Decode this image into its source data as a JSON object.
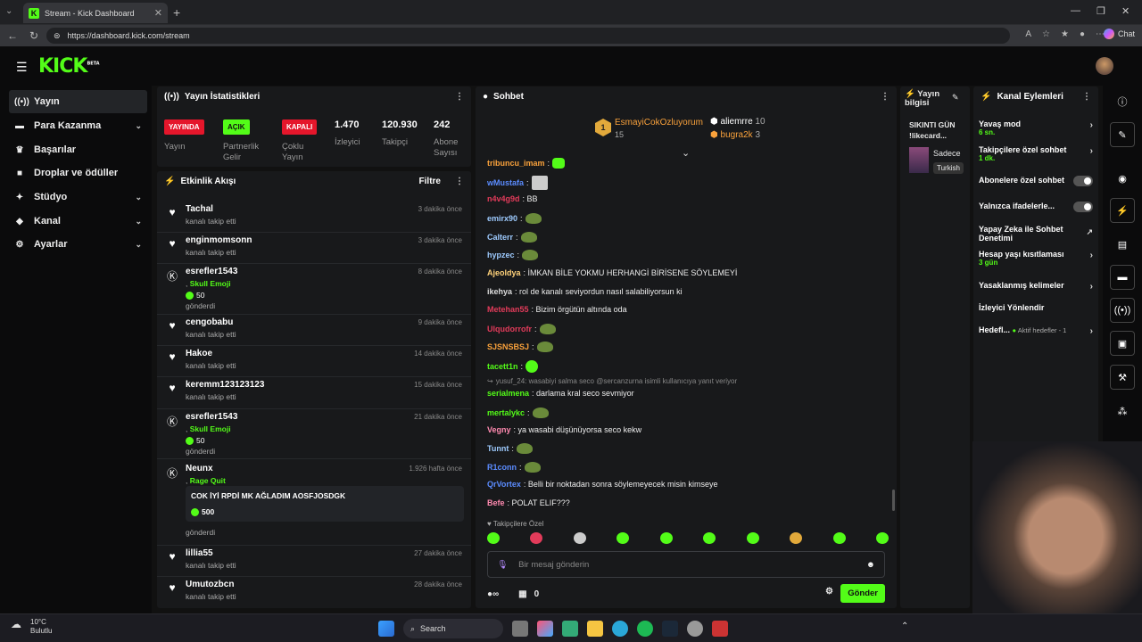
{
  "browser": {
    "tab_title": "Stream - Kick Dashboard",
    "url": "https://dashboard.kick.com/stream",
    "chat_label": "Chat"
  },
  "header": {
    "logo": "KICK",
    "logo_sup": "BETA"
  },
  "sidebar": {
    "items": [
      {
        "label": "Yayın",
        "icon": "broadcast-icon"
      },
      {
        "label": "Para Kazanma",
        "icon": "money-icon"
      },
      {
        "label": "Başarılar",
        "icon": "trophy-icon"
      },
      {
        "label": "Droplar ve ödüller",
        "icon": "gift-icon"
      },
      {
        "label": "Stüdyo",
        "icon": "studio-icon"
      },
      {
        "label": "Kanal",
        "icon": "channel-icon"
      },
      {
        "label": "Ayarlar",
        "icon": "gear-icon"
      }
    ]
  },
  "stats": {
    "title": "Yayın İstatistikleri",
    "badges": [
      {
        "badge": "YAYINDA",
        "label": "Yayın"
      },
      {
        "badge": "AÇIK",
        "label": "Partnerlik Gelir"
      },
      {
        "badge": "KAPALI",
        "label": "Çoklu Yayın"
      }
    ],
    "numbers": [
      {
        "value": "1.470",
        "label": "İzleyici"
      },
      {
        "value": "120.930",
        "label": "Takipçi"
      },
      {
        "value": "242",
        "label": "Abone Sayısı"
      }
    ]
  },
  "activity": {
    "title": "Etkinlik Akışı",
    "filter": "Filtre",
    "items": [
      {
        "user": "Tachal",
        "sub": "kanalı takip etti",
        "time": "3 dakika önce"
      },
      {
        "user": "enginmomsonn",
        "sub": "kanalı takip etti",
        "time": "3 dakika önce"
      },
      {
        "user": "esrefler1543",
        "emoji": "Skull Emoji",
        "amount": "50",
        "sub": "gönderdi",
        "time": "8 dakika önce"
      },
      {
        "user": "cengobabu",
        "sub": "kanalı takip etti",
        "time": "9 dakika önce"
      },
      {
        "user": "Hakoe",
        "sub": "kanalı takip etti",
        "time": "14 dakika önce"
      },
      {
        "user": "keremm123123123",
        "sub": "kanalı takip etti",
        "time": "15 dakika önce"
      },
      {
        "user": "esrefler1543",
        "emoji": "Skull Emoji",
        "amount": "50",
        "sub": "gönderdi",
        "time": "21 dakika önce"
      },
      {
        "user": "Neunx",
        "emoji": "Rage Quit",
        "message": "COK İYİ RPDİ MK AĞLADIM AOSFJOSDGK",
        "amount": "500",
        "sub": "gönderdi",
        "time": "1.926 hafta önce"
      },
      {
        "user": "lillia55",
        "sub": "kanalı takip etti",
        "time": "27 dakika önce"
      },
      {
        "user": "Umutozbcn",
        "sub": "kanalı takip etti",
        "time": "28 dakika önce"
      }
    ]
  },
  "chat": {
    "title": "Sohbet",
    "leaders": [
      {
        "rank": "1",
        "name": "EsmayiCokOzluyorum",
        "count": "15"
      },
      {
        "name": "aliemrre",
        "count": "10"
      },
      {
        "name": "bugra2k",
        "count": "3"
      }
    ],
    "messages": [
      {
        "user": "tribuncu_imam",
        "color": "#f9a13b",
        "text": ":",
        "emote": "bfly"
      },
      {
        "user": "wMustafa",
        "color": "#5b8cff",
        "text": ":",
        "emote": "cat"
      },
      {
        "user": "n4v4g9d",
        "color": "#e23b5a",
        "text": ": BB"
      },
      {
        "user": "emirx90",
        "color": "#9ecbff",
        "text": ":",
        "emote": "pepe"
      },
      {
        "user": "Calterr",
        "color": "#9ecbff",
        "text": ":",
        "emote": "pepe"
      },
      {
        "user": "hypzec",
        "color": "#9ecbff",
        "text": ":",
        "emote": "pepe"
      },
      {
        "user": "Ajeoldya",
        "color": "#ffd27a",
        "text": ": İMKAN BİLE YOKMU HERHANGİ BİRİSENE SÖYLEMEYİ"
      },
      {
        "user": "ikehya",
        "color": "#dddddd",
        "text": ": rol de kanalı seviyordun nasıl salabiliyorsun ki"
      },
      {
        "user": "Metehan55",
        "color": "#e23b5a",
        "text": ": Bizim örgütün altında oda"
      },
      {
        "user": "Ulqudorrofr",
        "color": "#e23b5a",
        "text": ":",
        "emote": "pepe"
      },
      {
        "user": "SJSNSBSJ",
        "color": "#f9a13b",
        "text": ":",
        "emote": "pepe"
      },
      {
        "user": "tacett1n",
        "color": "#53fc18",
        "text": ":",
        "emote": "face"
      },
      {
        "reply": "yusuf_24: wasabiyi salma seco @sercanzurna isimli kullanıcıya yanıt veriyor"
      },
      {
        "user": "serialmena",
        "color": "#53fc18",
        "text": ": darlama kral seco sevmiyor"
      },
      {
        "user": "mertalykc",
        "color": "#53fc18",
        "text": ":",
        "emote": "pepe"
      },
      {
        "user": "Vegny",
        "color": "#ff8ab0",
        "text": ": ya wasabi düşünüyorsa seco kekw"
      },
      {
        "user": "Tunnt",
        "color": "#9ecbff",
        "text": ":",
        "emote": "pepe"
      },
      {
        "user": "R1conn",
        "color": "#5b8cff",
        "text": ":",
        "emote": "pepe"
      },
      {
        "user": "QrVortex",
        "color": "#5b8cff",
        "text": ": Belli bir noktadan sonra söylemeyecek misin kimseye"
      },
      {
        "user": "Befe",
        "color": "#ff8ab0",
        "text": ": POLAT ELIF???"
      }
    ],
    "followers_only": "Takipçilere Özel",
    "input_placeholder": "Bir mesaj gönderin",
    "points": "0",
    "send": "Gönder"
  },
  "info": {
    "title": "Yayın bilgisi",
    "stream_title": "SIKINTI GÜN !likecard...",
    "category": "Sadece",
    "language": "Turkish"
  },
  "actions": {
    "title": "Kanal Eylemleri",
    "rows": [
      {
        "label": "Yavaş mod",
        "sub": "6 sn."
      },
      {
        "label": "Takipçilere özel sohbet",
        "sub": "1 dk."
      },
      {
        "label": "Abonelere özel sohbet"
      },
      {
        "label": "Yalnızca ifadelerle..."
      },
      {
        "label": "Yapay Zeka ile Sohbet Denetimi"
      },
      {
        "label": "Hesap yaşı kısıtlaması",
        "sub": "3 gün"
      },
      {
        "label": "Yasaklanmış kelimeler"
      },
      {
        "label": "İzleyici Yönlendir"
      },
      {
        "label": "Hedefl...",
        "sub": "Aktif hedefler - 1"
      }
    ]
  },
  "taskbar": {
    "temp": "10°C",
    "weather": "Bulutlu",
    "search": "Search"
  }
}
